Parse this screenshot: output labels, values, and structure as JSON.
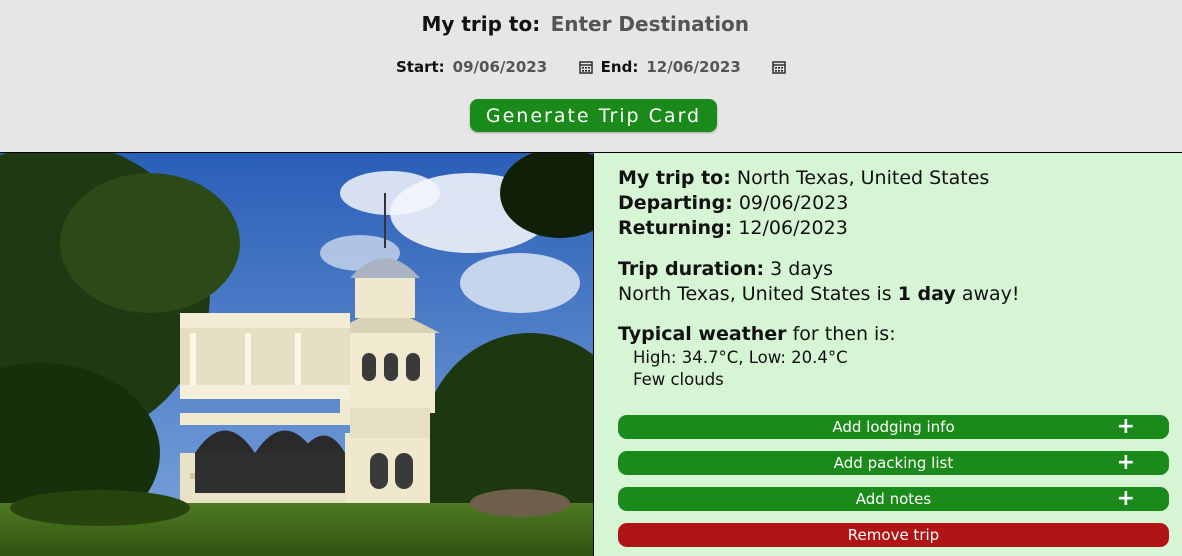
{
  "search": {
    "dest_label": "My trip to:",
    "dest_placeholder": "Enter Destination",
    "start_label": "Start:",
    "start_value": "09/06/2023",
    "end_label": "End:",
    "end_value": "12/06/2023",
    "generate_label": "Generate Trip Card"
  },
  "card": {
    "dest_label": "My trip to:",
    "dest_value": "North Texas, United States",
    "departing_label": "Departing:",
    "departing_value": "09/06/2023",
    "returning_label": "Returning:",
    "returning_value": "12/06/2023",
    "duration_label": "Trip duration:",
    "duration_value": "3 days",
    "away_prefix": "North Texas, United States is",
    "away_value": "1 day",
    "away_suffix": "away!",
    "weather_label": "Typical weather",
    "weather_suffix": "for then is:",
    "weather_temps": "High: 34.7°C, Low: 20.4°C",
    "weather_desc": "Few clouds",
    "buttons": {
      "lodging": "Add lodging info",
      "packing": "Add packing list",
      "notes": "Add notes",
      "remove": "Remove trip",
      "plus": "+"
    }
  },
  "colors": {
    "accent_green": "#1a8a1a",
    "danger_red": "#b01414",
    "card_bg": "#d5f5d5",
    "header_bg": "#e6e6e6"
  },
  "icons": [
    "calendar-icon",
    "plus-icon"
  ]
}
